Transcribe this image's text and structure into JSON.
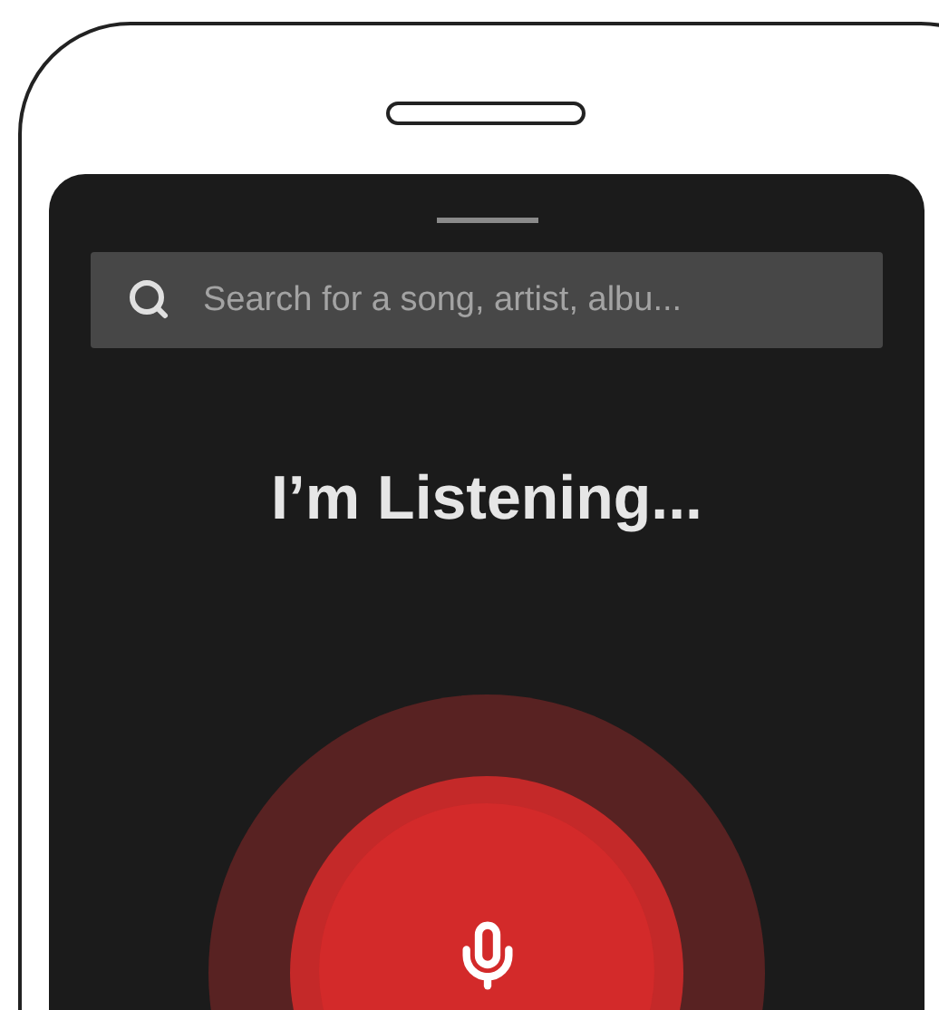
{
  "search": {
    "placeholder": "Search for a song, artist, albu..."
  },
  "heading": "I’m Listening...",
  "listening": true
}
